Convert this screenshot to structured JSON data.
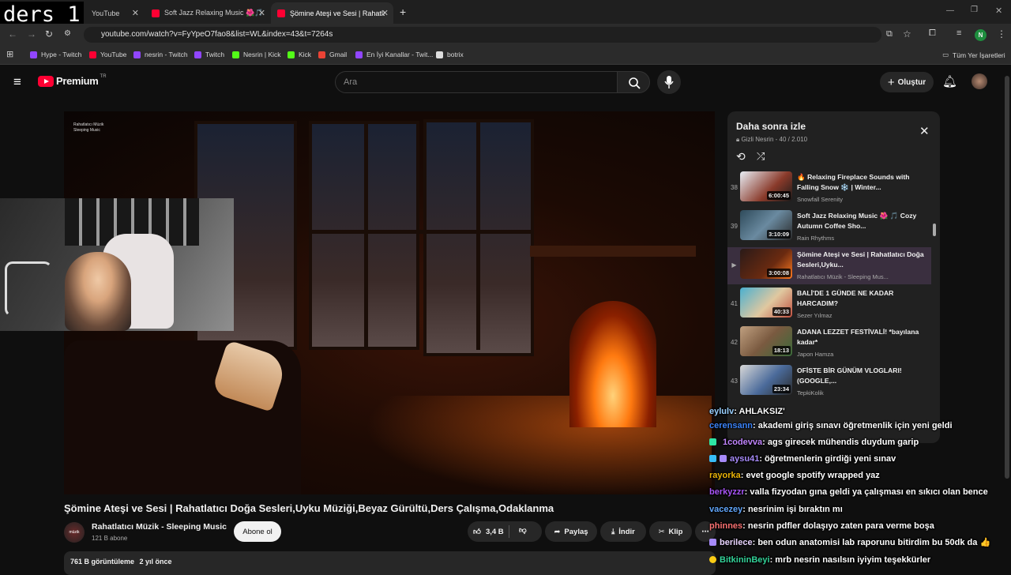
{
  "overlay_text": "ders 1",
  "browser": {
    "tabs": [
      {
        "label": "YouTube",
        "active": false
      },
      {
        "label": "Soft Jazz Relaxing Music 🌺🎵",
        "active": false
      },
      {
        "label": "Şömine Ateşi ve Sesi | Rahatlatı",
        "active": true
      }
    ],
    "new_tab": "+",
    "url": "youtube.com/watch?v=FyYpeO7fao8&list=WL&index=43&t=7264s",
    "profile_initial": "N",
    "bookmarks": [
      {
        "label": "Hype - Twitch",
        "color": "#9146ff"
      },
      {
        "label": "YouTube",
        "color": "#ff0033"
      },
      {
        "label": "nesrin - Twitch",
        "color": "#9146ff"
      },
      {
        "label": "Twitch",
        "color": "#9146ff"
      },
      {
        "label": "Nesrin | Kick",
        "color": "#53fc18"
      },
      {
        "label": "Kick",
        "color": "#53fc18"
      },
      {
        "label": "Gmail",
        "color": "#ea4335"
      },
      {
        "label": "En İyi Kanallar - Twit...",
        "color": "#9146ff"
      },
      {
        "label": "botrix",
        "color": "#dddddd"
      }
    ],
    "all_bookmarks": "Tüm Yer İşaretleri"
  },
  "youtube": {
    "logo": "Premium",
    "region": "TR",
    "search_placeholder": "Ara",
    "create_label": "Oluştur"
  },
  "video": {
    "watermark_line1": "Rahatlatıcı Müzik",
    "watermark_line2": "Sleeping Music",
    "title": "Şömine Ateşi ve Sesi | Rahatlatıcı Doğa Sesleri,Uyku Müziği,Beyaz Gürültü,Ders Çalışma,Odaklanma",
    "channel": "Rahatlatıcı Müzik - Sleeping Music",
    "avatar_text": "müzik",
    "subscribers": "121 B abone",
    "subscribe_label": "Abone ol",
    "likes": "3,4 B",
    "share_label": "Paylaş",
    "download_label": "İndir",
    "clip_label": "Klip",
    "views": "761 B görüntüleme",
    "age": "2 yıl önce"
  },
  "playlist": {
    "title": "Daha sonra izle",
    "subtitle": "Gizli Nesrin - 40 / 2.010",
    "items": [
      {
        "index": "38",
        "title": "🔥 Relaxing Fireplace Sounds with Falling Snow ❄️ | Winter...",
        "channel": "Snowfall Serenity",
        "duration": "6:00:45",
        "current": false
      },
      {
        "index": "39",
        "title": "Soft Jazz Relaxing Music 🌺 🎵 Cozy Autumn Coffee Sho...",
        "channel": "Rain Rhythms",
        "duration": "3:10:09",
        "current": false
      },
      {
        "index": "▶",
        "title": "Şömine Ateşi ve Sesi | Rahatlatıcı Doğa Sesleri,Uyku...",
        "channel": "Rahatlatıcı Müzik - Sleeping Mus...",
        "duration": "3:00:08",
        "current": true
      },
      {
        "index": "41",
        "title": "BALİ'DE 1 GÜNDE NE KADAR HARCADIM?",
        "channel": "Sezer Yılmaz",
        "duration": "40:33",
        "current": false
      },
      {
        "index": "42",
        "title": "ADANA LEZZET FESTİVALİ! *bayılana kadar*",
        "channel": "Japon Hamza",
        "duration": "18:13",
        "current": false
      },
      {
        "index": "43",
        "title": "OFİSTE BİR GÜNÜM VLOGLARI! (GOOGLE,...",
        "channel": "TepkiKolik",
        "duration": "23:34",
        "current": false
      }
    ]
  },
  "chat": [
    {
      "user": "eylulv",
      "user_color": "#9ad0ff",
      "text": ": AHLAKSIZ'",
      "badge": ""
    },
    {
      "user": "cerensann",
      "user_color": "#3b82f6",
      "text": ": akademi giriş sınavı öğretmenlik için yeni geldi",
      "badge": ""
    },
    {
      "user": "1codevva",
      "user_color": "#c084fc",
      "text": ": ags girecek mühendis duydum garip",
      "badge": "#2ee6a6"
    },
    {
      "user": "aysu41",
      "user_color": "#a78bfa",
      "text": ": öğretmenlerin girdiği yeni sınav",
      "badge": "#38bdf8"
    },
    {
      "user": "rayorka",
      "user_color": "#eab308",
      "text": ": evet google spotify wrapped yaz",
      "badge": ""
    },
    {
      "user": "berkyzzr",
      "user_color": "#a855f7",
      "text": ": valla fizyodan gına geldi ya çalışması en sıkıcı olan bence",
      "badge": ""
    },
    {
      "user": "vacezey",
      "user_color": "#60a5fa",
      "text": ": nesrinim işi bıraktın mı",
      "badge": ""
    },
    {
      "user": "phinnes",
      "user_color": "#f87171",
      "text": ": nesrin pdfler dolaşıyo zaten para verme boşa",
      "badge": ""
    },
    {
      "user": "berilece",
      "user_color": "#e9d5ff",
      "text": ": ben odun anatomisi lab raporunu bitirdim bu 50dk da 👍",
      "badge": "#a78bfa"
    },
    {
      "user": "BitkininBeyi",
      "user_color": "#34d399",
      "text": ": mrb nesrin nasılsın iyiyim teşekkürler",
      "badge": "#facc15"
    }
  ]
}
